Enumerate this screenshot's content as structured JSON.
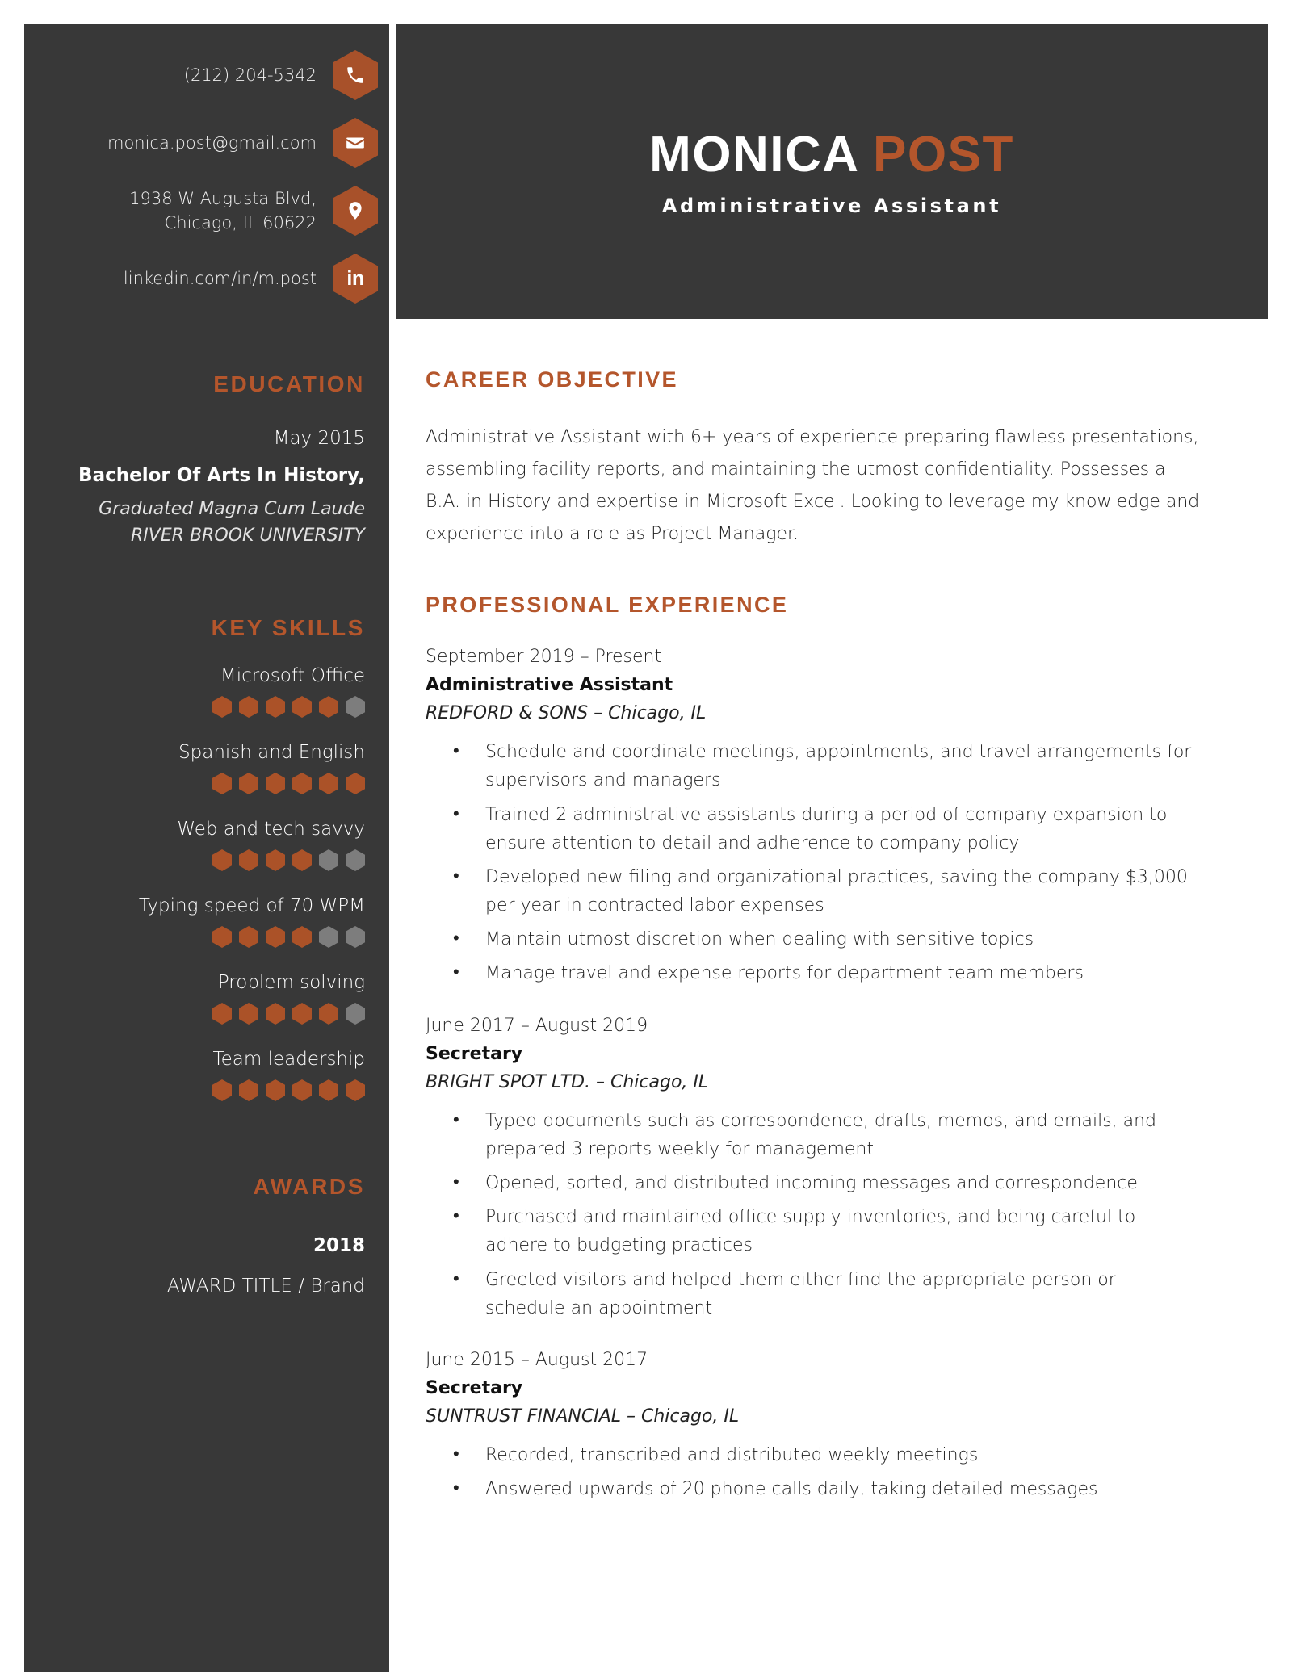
{
  "theme": {
    "accent": "#b4562c",
    "sidebar_bg": "#383838",
    "dot_on": "#ab5228",
    "dot_off": "#7d7d7d",
    "page_bg": "#ffffff"
  },
  "header": {
    "first_name": "MONICA",
    "last_name": "POST",
    "job_title": "Administrative Assistant"
  },
  "contact": [
    {
      "icon": "phone-icon",
      "text": "(212) 204-5342"
    },
    {
      "icon": "envelope-icon",
      "text": "monica.post@gmail.com"
    },
    {
      "icon": "location-pin-icon",
      "line1": "1938 W Augusta Blvd,",
      "line2": "Chicago, IL 60622"
    },
    {
      "icon": "linkedin-icon",
      "text": "linkedin.com/in/m.post"
    }
  ],
  "education": {
    "heading": "EDUCATION",
    "date": "May 2015",
    "degree": "Bachelor Of Arts In History,",
    "honors": "Graduated Magna Cum Laude",
    "school": "RIVER BROOK UNIVERSITY"
  },
  "key_skills": {
    "heading": "KEY SKILLS",
    "max_rating": 6,
    "items": [
      {
        "label": "Microsoft Office",
        "rating": 5
      },
      {
        "label": "Spanish and English",
        "rating": 6
      },
      {
        "label": "Web and tech savvy",
        "rating": 4
      },
      {
        "label": "Typing speed of 70 WPM",
        "rating": 4
      },
      {
        "label": "Problem solving",
        "rating": 5
      },
      {
        "label": "Team leadership",
        "rating": 6
      }
    ]
  },
  "awards": {
    "heading": "AWARDS",
    "year": "2018",
    "title": "AWARD TITLE / Brand"
  },
  "career_objective": {
    "heading": "CAREER OBJECTIVE",
    "text": "Administrative Assistant with 6+ years of experience preparing flawless presentations, assembling facility reports, and maintaining the utmost confidentiality. Possesses a B.A. in History and expertise in Microsoft Excel. Looking to leverage my knowledge and experience into a role as Project Manager."
  },
  "professional_experience": {
    "heading": "PROFESSIONAL EXPERIENCE",
    "jobs": [
      {
        "dates": "September 2019 – Present",
        "role": "Administrative Assistant",
        "company": "REDFORD & SONS – Chicago, IL",
        "bullets": [
          "Schedule and coordinate meetings, appointments, and travel arrangements for supervisors and managers",
          "Trained 2 administrative assistants during a period of company expansion to ensure attention to detail and adherence to company policy",
          "Developed new filing and organizational practices, saving the company $3,000 per year in contracted labor expenses",
          "Maintain utmost discretion when dealing with sensitive topics",
          "Manage travel and expense reports for department team members"
        ]
      },
      {
        "dates": "June 2017 – August 2019",
        "role": "Secretary",
        "company": "BRIGHT SPOT LTD. – Chicago, IL",
        "bullets": [
          "Typed documents such as correspondence, drafts, memos, and emails, and prepared 3 reports weekly for management",
          "Opened, sorted, and distributed incoming messages and correspondence",
          "Purchased and maintained office supply inventories, and being careful to adhere to budgeting practices",
          "Greeted visitors and helped them either find the appropriate person or schedule an appointment"
        ]
      },
      {
        "dates": "June 2015 – August 2017",
        "role": "Secretary",
        "company": "SUNTRUST FINANCIAL – Chicago, IL",
        "bullets": [
          "Recorded, transcribed and distributed weekly meetings",
          "Answered upwards of 20 phone calls daily, taking detailed messages"
        ]
      }
    ]
  }
}
